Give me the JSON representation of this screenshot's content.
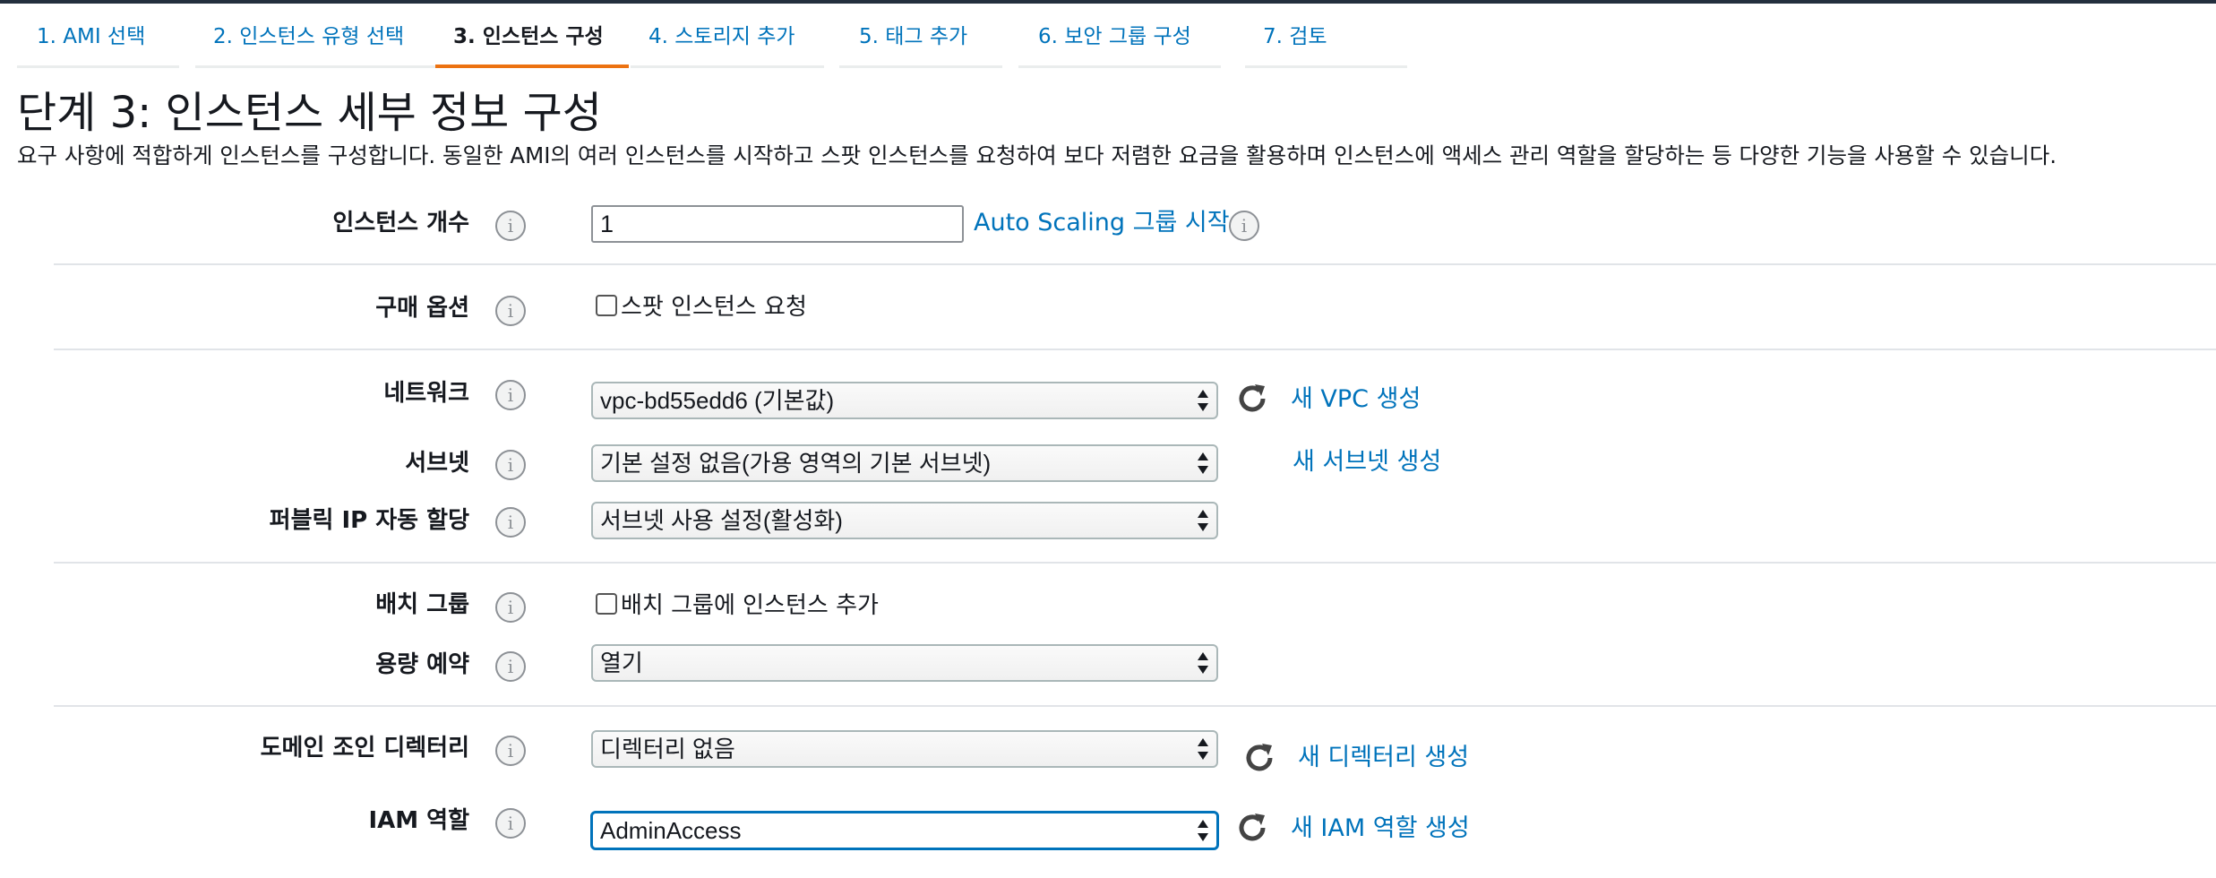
{
  "wizard": {
    "steps": [
      {
        "label": "1. AMI 선택"
      },
      {
        "label": "2. 인스턴스 유형 선택"
      },
      {
        "label": "3. 인스턴스 구성"
      },
      {
        "label": "4. 스토리지 추가"
      },
      {
        "label": "5. 태그 추가"
      },
      {
        "label": "6. 보안 그룹 구성"
      },
      {
        "label": "7. 검토"
      }
    ],
    "active_step": 3
  },
  "page": {
    "title": "단계 3: 인스턴스 세부 정보 구성",
    "description": "요구 사항에 적합하게 인스턴스를 구성합니다. 동일한 AMI의 여러 인스턴스를 시작하고 스팟 인스턴스를 요청하여 보다 저렴한 요금을 활용하며 인스턴스에 액세스 관리 역할을 할당하는 등 다양한 기능을 사용할 수 있습니다."
  },
  "form": {
    "instance_count": {
      "label": "인스턴스 개수",
      "value": "1",
      "link": "Auto Scaling 그룹 시작"
    },
    "purchase_option": {
      "label": "구매 옵션",
      "checkbox_label": "스팟 인스턴스 요청",
      "checked": false
    },
    "network": {
      "label": "네트워크",
      "value": "vpc-bd55edd6 (기본값)",
      "link": "새 VPC 생성"
    },
    "subnet": {
      "label": "서브넷",
      "value": "기본 설정 없음(가용 영역의 기본 서브넷)",
      "link": "새 서브넷 생성"
    },
    "public_ip": {
      "label": "퍼블릭 IP 자동 할당",
      "value": "서브넷 사용 설정(활성화)"
    },
    "placement_group": {
      "label": "배치 그룹",
      "checkbox_label": "배치 그룹에 인스턴스 추가",
      "checked": false
    },
    "capacity_reservation": {
      "label": "용량 예약",
      "value": "열기"
    },
    "domain_join": {
      "label": "도메인 조인 디렉터리",
      "value": "디렉터리 없음",
      "link": "새 디렉터리 생성"
    },
    "iam_role": {
      "label": "IAM 역할",
      "value": "AdminAccess",
      "link": "새 IAM 역할 생성"
    }
  },
  "icons": {
    "info": "info-icon",
    "refresh": "refresh-icon",
    "select_arrows": "select-arrows-icon"
  },
  "colors": {
    "link": "#0073bb",
    "active_tab_underline": "#ec7211",
    "focus_border": "#0073bb"
  }
}
